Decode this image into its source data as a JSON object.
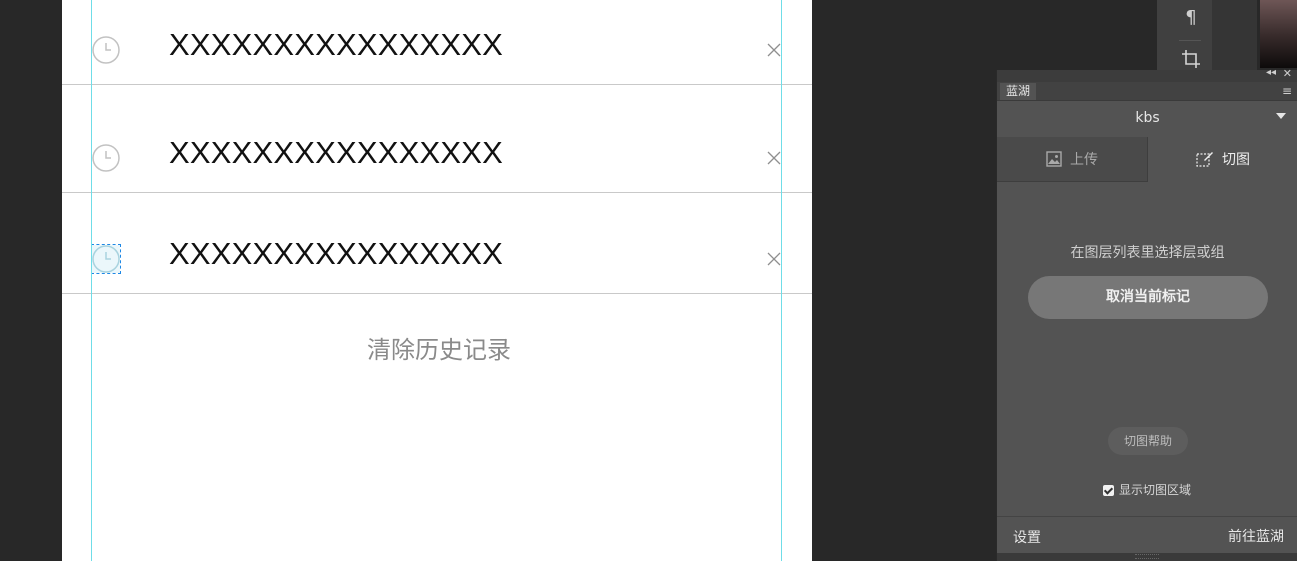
{
  "canvas": {
    "rows": [
      {
        "text": "XXXXXXXXXXXXXXXX"
      },
      {
        "text": "XXXXXXXXXXXXXXXX"
      },
      {
        "text": "XXXXXXXXXXXXXXXX"
      }
    ],
    "clear_history": "清除历史记录"
  },
  "toolbar": {
    "tools": [
      "paragraph-icon",
      "crop-icon"
    ]
  },
  "panel": {
    "tab_title": "蓝湖",
    "project_name": "kbs",
    "tabs": [
      {
        "label": "上传",
        "icon": "image-icon",
        "active": false
      },
      {
        "label": "切图",
        "icon": "slice-icon",
        "active": true
      }
    ],
    "hint": "在图层列表里选择层或组",
    "cancel_mark_button": "取消当前标记",
    "help_button": "切图帮助",
    "show_area_label": "显示切图区域",
    "show_area_checked": true,
    "footer": {
      "settings": "设置",
      "goto_lanhu": "前往蓝湖"
    }
  },
  "colors": {
    "app_background": "#282828",
    "panel_background": "#535353",
    "guide_line": "#6fdde8",
    "selection_outline": "#1e88e5"
  }
}
